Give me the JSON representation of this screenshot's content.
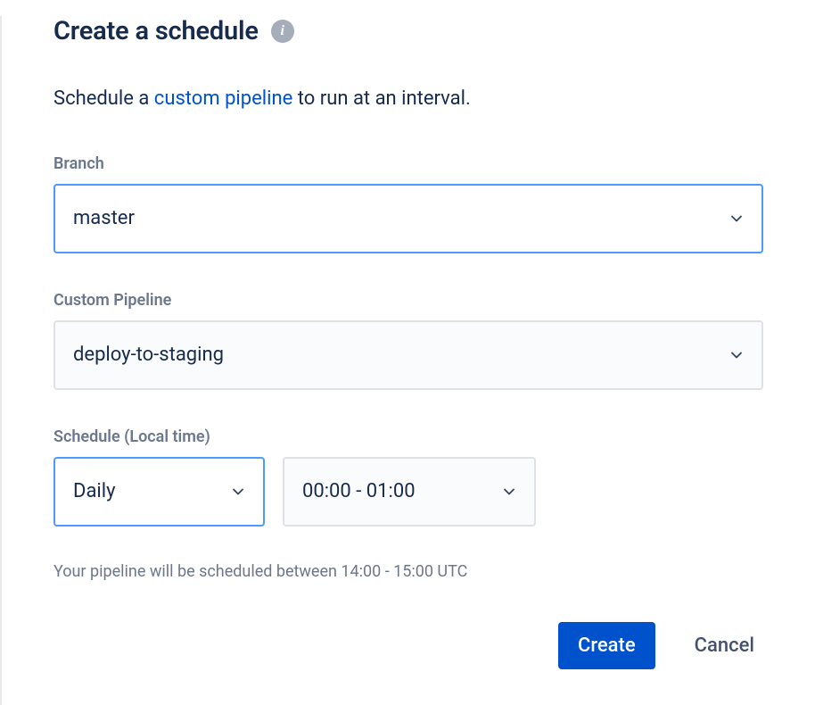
{
  "title": "Create a schedule",
  "description_prefix": "Schedule a ",
  "description_link": "custom pipeline",
  "description_suffix": " to run at an interval.",
  "branch": {
    "label": "Branch",
    "value": "master"
  },
  "pipeline": {
    "label": "Custom Pipeline",
    "value": "deploy-to-staging"
  },
  "schedule": {
    "label": "Schedule (Local time)",
    "frequency": "Daily",
    "time_range": "00:00 - 01:00",
    "helper": "Your pipeline will be scheduled between 14:00 - 15:00 UTC"
  },
  "actions": {
    "create": "Create",
    "cancel": "Cancel"
  }
}
